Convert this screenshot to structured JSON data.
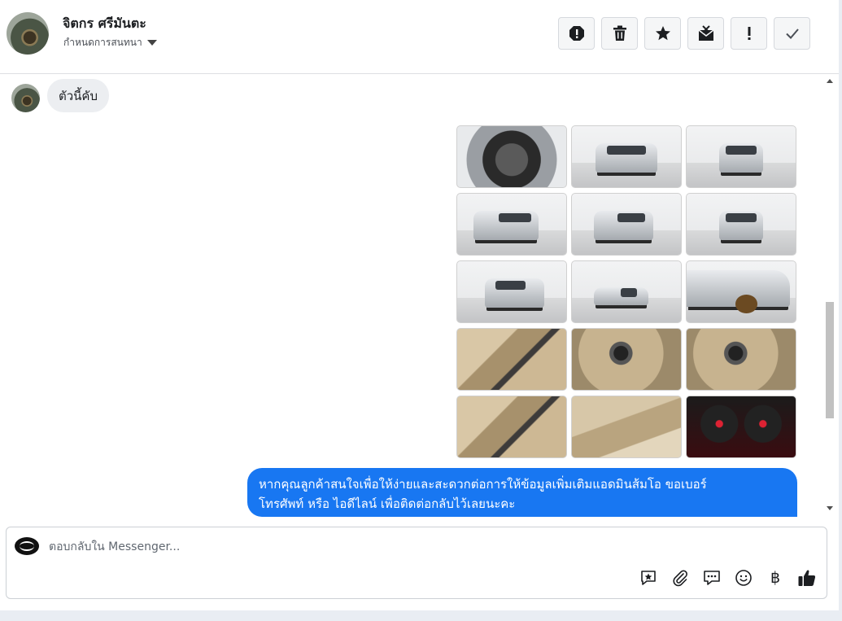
{
  "header": {
    "contact_name": "จิตกร ศรีมันตะ",
    "status_label": "กำหนดการสนทนา",
    "actions": [
      {
        "name": "spam-button",
        "icon": "octagon-alert-icon"
      },
      {
        "name": "delete-button",
        "icon": "trash-icon"
      },
      {
        "name": "star-button",
        "icon": "star-icon"
      },
      {
        "name": "mark-unread-button",
        "icon": "envelope-x-icon"
      },
      {
        "name": "important-button",
        "icon": "exclamation-icon"
      },
      {
        "name": "done-button",
        "icon": "check-icon"
      }
    ]
  },
  "messages": {
    "incoming_text": "ตัวนี้คับ",
    "photos": [
      "engine",
      "studio-front",
      "studio-front",
      "studio-side",
      "studio-rear",
      "studio-rear",
      "studio-rear-side",
      "studio-side-far",
      "wheel",
      "door-interior",
      "steering",
      "steering",
      "front-seats",
      "rear-seats",
      "gauges"
    ],
    "outgoing_line1": "หากคุณลูกค้าสนใจเพื่อให้ง่ายและสะดวกต่อการให้ข้อมูลเพิ่มเติมแอดมินส้มโอ ขอเบอร์",
    "outgoing_line2": "โทรศัพท์ หรือ ไอดีไลน์ เพื่อติดต่อกลับไว้เลยนะคะ"
  },
  "composer": {
    "placeholder": "ตอบกลับใน Messenger...",
    "tools": [
      "saved-reply-icon",
      "paperclip-icon",
      "chat-bubble-icon",
      "emoji-icon",
      "baht-icon",
      "thumbs-up-icon"
    ],
    "currency_symbol": "฿"
  },
  "colors": {
    "accent": "#1877f2",
    "incoming_bubble": "#eceef1"
  }
}
